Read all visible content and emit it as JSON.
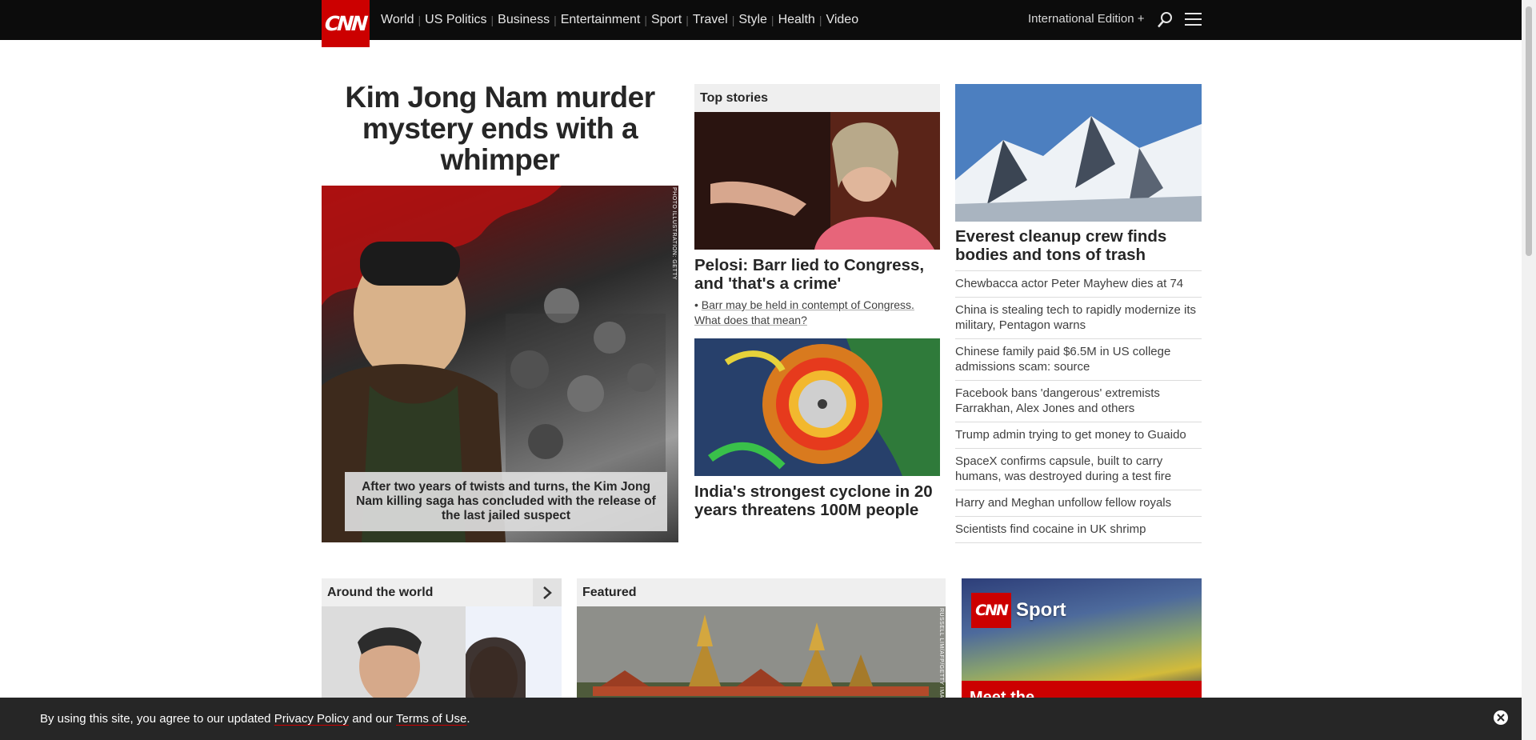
{
  "nav": {
    "logo": "CNN",
    "links": [
      "World",
      "US Politics",
      "Business",
      "Entertainment",
      "Sport",
      "Travel",
      "Style",
      "Health",
      "Video"
    ],
    "edition": "International Edition +"
  },
  "hero": {
    "title": "Kim Jong Nam murder mystery ends with a whimper",
    "caption": "After two years of twists and turns, the Kim Jong Nam killing saga has concluded with the release of the last jailed suspect",
    "photo_credit": "PHOTO ILLUSTRATION: GETTY"
  },
  "top_stories": {
    "label": "Top stories",
    "story1": {
      "headline": "Pelosi: Barr lied to Congress, and 'that's a crime'",
      "sub": "Barr may be held in contempt of Congress. What does that mean?"
    },
    "story2": {
      "headline": "India's strongest cyclone in 20 years threatens 100M people"
    }
  },
  "right_column": {
    "headline": "Everest cleanup crew finds bodies and tons of trash",
    "items": [
      "Chewbacca actor Peter Mayhew dies at 74",
      "China is stealing tech to rapidly modernize its military, Pentagon warns",
      "Chinese family paid $6.5M in US college admissions scam: source",
      "Facebook bans 'dangerous' extremists Farrakhan, Alex Jones and others",
      "Trump admin trying to get money to Guaido",
      "SpaceX confirms capsule, built to carry humans, was destroyed during a test fire",
      "Harry and Meghan unfollow fellow royals",
      "Scientists find cocaine in UK shrimp"
    ]
  },
  "row2": {
    "around_label": "Around the world",
    "featured_label": "Featured",
    "featured_credit": "RUSSELL LIM/AFP/GETTY IMAGES",
    "sport_logo": "CNN",
    "sport_label": "Sport",
    "sport_teaser": "Meet the"
  },
  "cookie": {
    "text_before": "By using this site, you agree to our updated ",
    "privacy": "Privacy Policy",
    "text_mid": " and our ",
    "terms": "Terms of Use",
    "text_after": "."
  }
}
